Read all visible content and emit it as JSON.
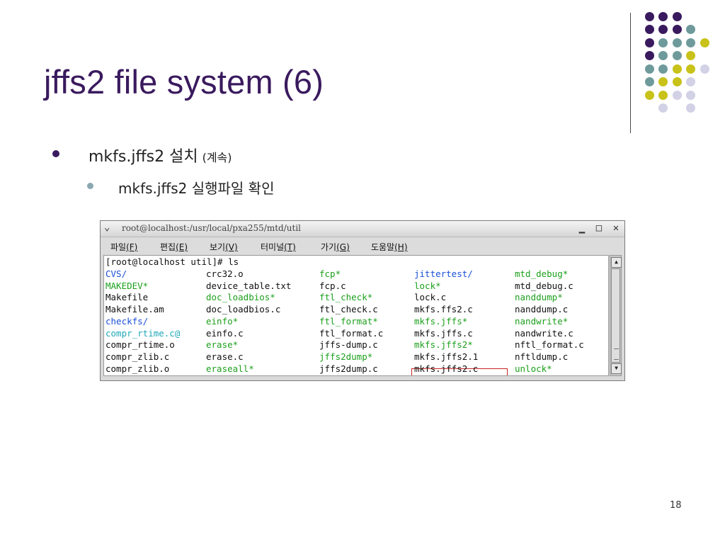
{
  "slide": {
    "title": "jffs2 file system (6)",
    "bullet1": "mkfs.jffs2 설치",
    "bullet1_note": "(계속)",
    "bullet2": "mkfs.jffs2 실행파일 확인",
    "page_number": "18"
  },
  "decor": {
    "dot_colors": {
      "purple": "#3a1a5e",
      "teal": "#6f9a9b",
      "yellow": "#c8c21a",
      "lavender": "#d2d1e6"
    }
  },
  "terminal": {
    "title": "root@localhost:/usr/local/pxa255/mtd/util",
    "window_buttons": {
      "minimize": "▁",
      "maximize": "□",
      "close": "✕"
    },
    "menu": [
      {
        "label": "파일",
        "key": "(F)"
      },
      {
        "label": "편집",
        "key": "(E)"
      },
      {
        "label": "보기",
        "key": "(V)"
      },
      {
        "label": "터미널",
        "key": "(T)"
      },
      {
        "label": "가기",
        "key": "(G)"
      },
      {
        "label": "도움말",
        "key": "(H)"
      }
    ],
    "prompt_line": "[root@localhost util]# ls",
    "listing": [
      [
        "CVS/",
        "crc32.o",
        "fcp*",
        "jittertest/",
        "mtd_debug*"
      ],
      [
        "MAKEDEV*",
        "device_table.txt",
        "fcp.c",
        "lock*",
        "mtd_debug.c"
      ],
      [
        "Makefile",
        "doc_loadbios*",
        "ftl_check*",
        "lock.c",
        "nanddump*"
      ],
      [
        "Makefile.am",
        "doc_loadbios.c",
        "ftl_check.c",
        "mkfs.ffs2.c",
        "nanddump.c"
      ],
      [
        "checkfs/",
        "einfo*",
        "ftl_format*",
        "mkfs.jffs*",
        "nandwrite*"
      ],
      [
        "compr_rtime.c@",
        "einfo.c",
        "ftl_format.c",
        "mkfs.jffs.c",
        "nandwrite.c"
      ],
      [
        "compr_rtime.o",
        "erase*",
        "jffs-dump.c",
        "mkfs.jffs2*",
        "nftl_format.c"
      ],
      [
        "compr_zlib.c",
        "erase.c",
        "jffs2dump*",
        "mkfs.jffs2.1",
        "nftldump.c"
      ],
      [
        "compr_zlib.o",
        "eraseall*",
        "jffs2dump.c",
        "mkfs.jffs2.c",
        "unlock*"
      ]
    ],
    "types": [
      [
        "dir",
        "file",
        "exe",
        "dir",
        "exe"
      ],
      [
        "exe",
        "file",
        "file",
        "exe",
        "file"
      ],
      [
        "file",
        "exe",
        "exe",
        "file",
        "exe"
      ],
      [
        "file",
        "file",
        "file",
        "file",
        "file"
      ],
      [
        "dir",
        "exe",
        "exe",
        "exe",
        "exe"
      ],
      [
        "link",
        "file",
        "file",
        "file",
        "file"
      ],
      [
        "file",
        "exe",
        "file",
        "exe",
        "file"
      ],
      [
        "file",
        "file",
        "exe",
        "file",
        "file"
      ],
      [
        "file",
        "exe",
        "file",
        "file",
        "exe"
      ]
    ],
    "scroll_up": "▲",
    "scroll_down": "▼"
  }
}
